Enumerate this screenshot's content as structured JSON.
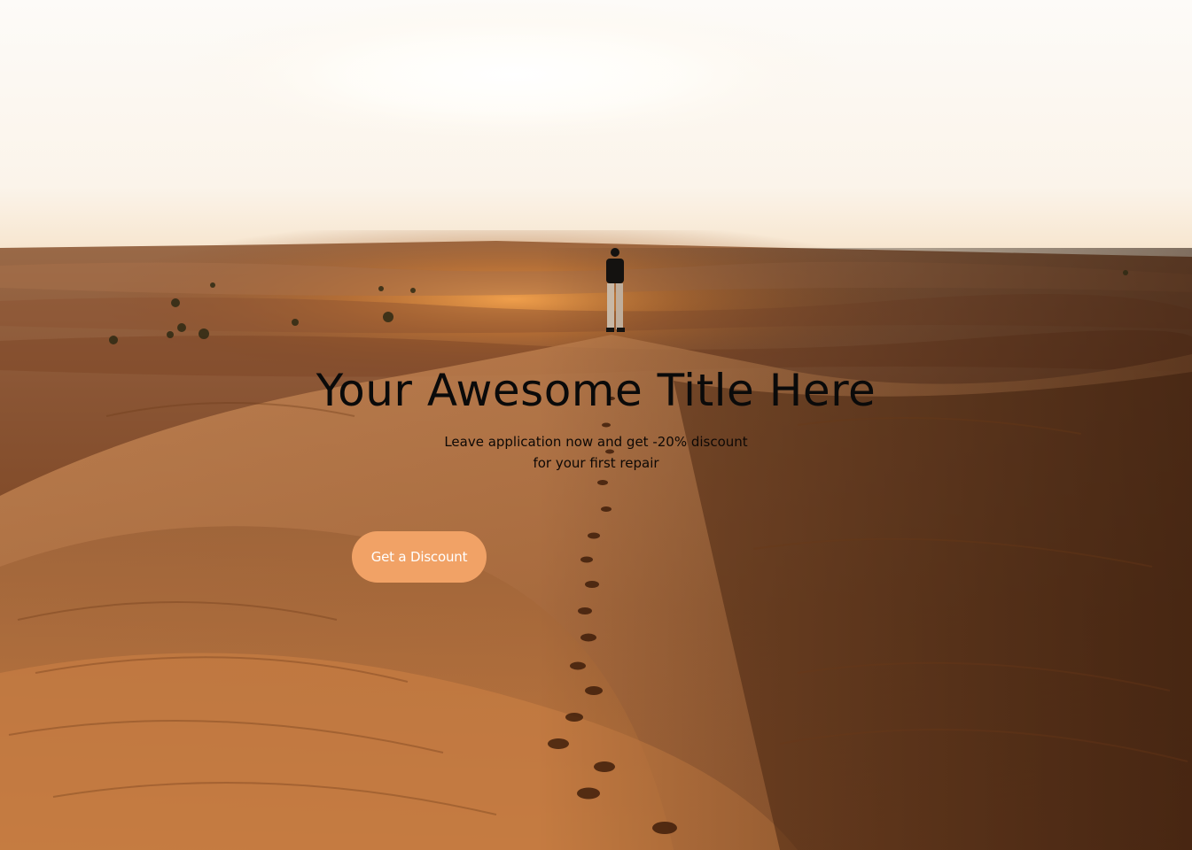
{
  "hero": {
    "title": "Your Awesome Title Here",
    "subtitle_line1": "Leave application now and get -20% discount",
    "subtitle_line2": "for your first repair",
    "cta_label": "Get a Discount",
    "cta_color": "#f1a266",
    "background_image": "desert-dunes-sunset-photo"
  }
}
